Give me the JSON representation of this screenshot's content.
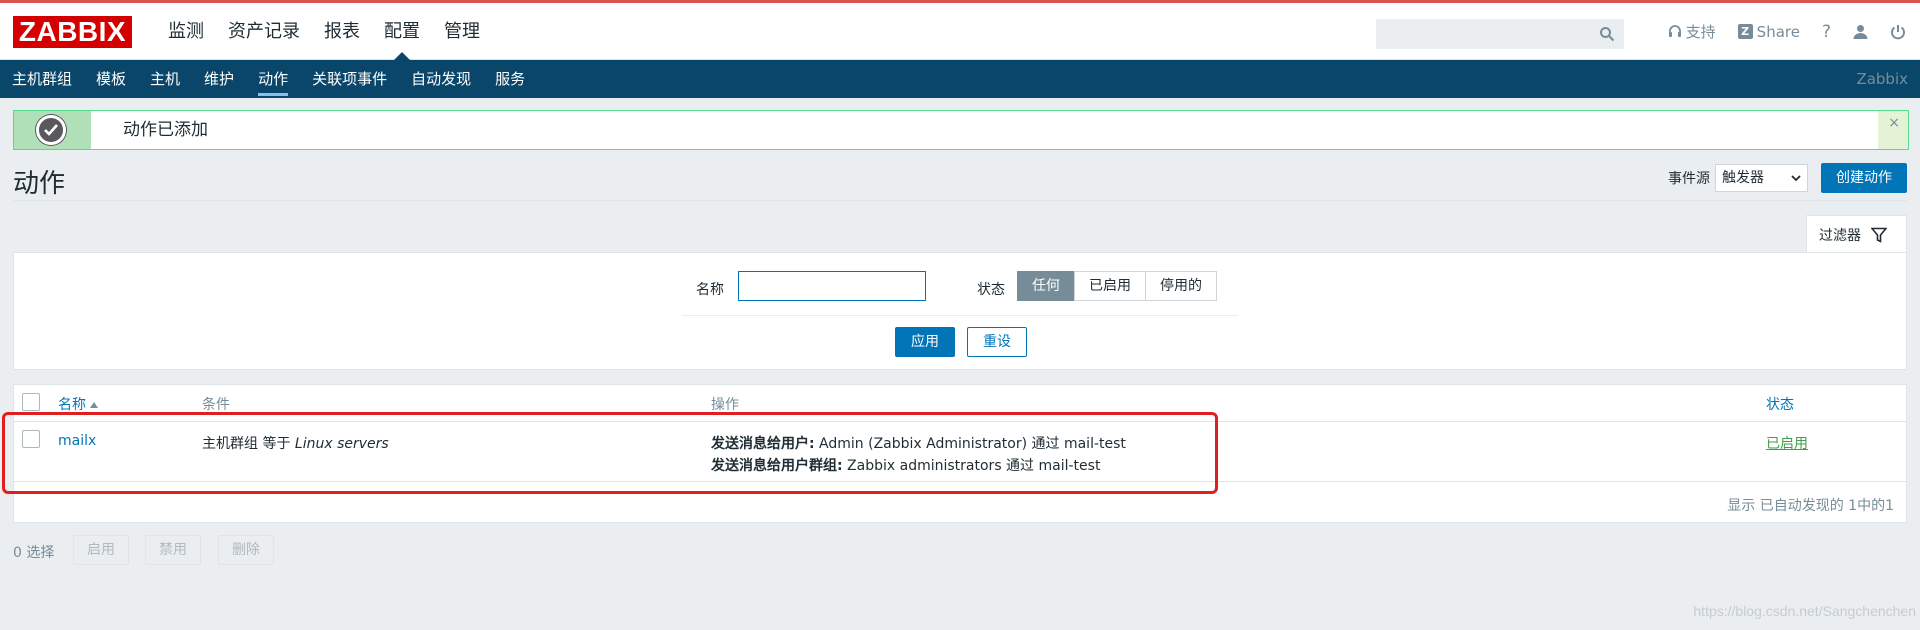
{
  "header": {
    "logo_text": "ZABBIX",
    "main_nav": [
      "监测",
      "资产记录",
      "报表",
      "配置",
      "管理"
    ],
    "active_main": "配置",
    "search": {
      "value": "",
      "placeholder": ""
    },
    "support_label": "支持",
    "share_label": "Share",
    "help_label": "?"
  },
  "subnav": {
    "items": [
      "主机群组",
      "模板",
      "主机",
      "维护",
      "动作",
      "关联项事件",
      "自动发现",
      "服务"
    ],
    "active": "动作",
    "brand": "Zabbix"
  },
  "message": {
    "text": "动作已添加",
    "close": "×"
  },
  "page": {
    "title": "动作",
    "event_source_label": "事件源",
    "event_source_value": "触发器",
    "create_button": "创建动作"
  },
  "filter": {
    "tab_label": "过滤器",
    "name_label": "名称",
    "name_value": "",
    "status_label": "状态",
    "status_options": [
      "任何",
      "已启用",
      "停用的"
    ],
    "status_selected": "任何",
    "apply_label": "应用",
    "reset_label": "重设"
  },
  "table": {
    "columns": [
      "名称",
      "条件",
      "操作",
      "状态"
    ],
    "rows": [
      {
        "name": "mailx",
        "condition_prefix": "主机群组 等于 ",
        "condition_value": "Linux servers",
        "op1_label": "发送消息给用户:",
        "op1_value": " Admin (Zabbix Administrator) 通过 mail-test",
        "op2_label": "发送消息给用户群组:",
        "op2_value": " Zabbix administrators 通过 mail-test",
        "status": "已启用"
      }
    ],
    "pager_text": "显示 已自动发现的 1中的1"
  },
  "footer": {
    "selected_count": "0 选择",
    "mass_buttons": [
      "启用",
      "禁用",
      "删除"
    ]
  },
  "watermark": "https://blog.csdn.net/Sangchenchen",
  "colors": {
    "brand_red": "#d40000",
    "nav_blue": "#0a466a",
    "primary_blue": "#0275b8",
    "success_green": "#429e47",
    "highlight_red": "#e02020"
  }
}
